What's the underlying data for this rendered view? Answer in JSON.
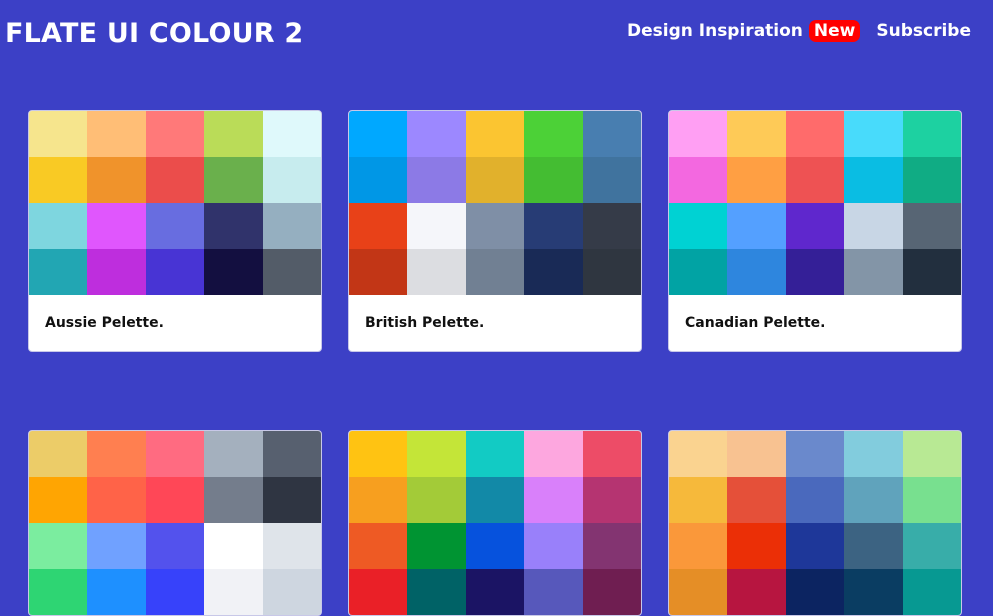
{
  "header": {
    "brand": "FLATE UI COLOUR 2",
    "nav": {
      "inspiration": "Design Inspiration",
      "badge": "New",
      "subscribe": "Subscribe"
    }
  },
  "colors": {
    "background": "#3c40c6",
    "badge": "#ff0000"
  },
  "palettes": [
    {
      "name": "Aussie Pelette.",
      "swatches": [
        "#f6e58d",
        "#ffbe76",
        "#ff7979",
        "#badc58",
        "#dff9fb",
        "#f9ca24",
        "#f0932b",
        "#eb4d4b",
        "#6ab04c",
        "#c7ecee",
        "#7ed6df",
        "#e056fd",
        "#686de0",
        "#30336b",
        "#95afc0",
        "#22a6b3",
        "#be2edd",
        "#4834d4",
        "#130f40",
        "#535c68"
      ]
    },
    {
      "name": "British Pelette.",
      "swatches": [
        "#00a8ff",
        "#9c88ff",
        "#fbc531",
        "#4cd137",
        "#487eb0",
        "#0097e6",
        "#8c7ae6",
        "#e1b12c",
        "#44bd32",
        "#40739e",
        "#e84118",
        "#f5f6fa",
        "#7f8fa6",
        "#273c75",
        "#353b48",
        "#c23616",
        "#dcdde1",
        "#718093",
        "#192a56",
        "#2f3640"
      ]
    },
    {
      "name": "Canadian Pelette.",
      "swatches": [
        "#ff9ff3",
        "#feca57",
        "#ff6b6b",
        "#48dbfb",
        "#1dd1a1",
        "#f368e0",
        "#ff9f43",
        "#ee5253",
        "#0abde3",
        "#10ac84",
        "#00d2d3",
        "#54a0ff",
        "#5f27cd",
        "#c8d6e5",
        "#576574",
        "#01a3a4",
        "#2e86de",
        "#341f97",
        "#8395a7",
        "#222f3e"
      ]
    },
    {
      "swatches": [
        "#eccc68",
        "#ff7f50",
        "#ff6b81",
        "#a4b0be",
        "#57606f",
        "#ffa502",
        "#ff6348",
        "#ff4757",
        "#747d8c",
        "#2f3542",
        "#7bed9f",
        "#70a1ff",
        "#5352ed",
        "#ffffff",
        "#dfe4ea",
        "#2ed573",
        "#1e90ff",
        "#3742fa",
        "#f1f2f6",
        "#ced6e0"
      ]
    },
    {
      "swatches": [
        "#ffc312",
        "#c4e538",
        "#12cbc4",
        "#fda7df",
        "#ed4c67",
        "#f79f1f",
        "#a3cb38",
        "#1289a7",
        "#d980fa",
        "#b53471",
        "#ee5a24",
        "#009432",
        "#0652dd",
        "#9980fa",
        "#833471",
        "#ea2027",
        "#006266",
        "#1b1464",
        "#5758bb",
        "#6f1e51"
      ]
    },
    {
      "swatches": [
        "#fad390",
        "#f8c291",
        "#6a89cc",
        "#82ccdd",
        "#b8e994",
        "#f6b93b",
        "#e55039",
        "#4a69bd",
        "#60a3bc",
        "#78e08f",
        "#fa983a",
        "#eb2f06",
        "#1e3799",
        "#3c6382",
        "#38ada9",
        "#e58e26",
        "#b71540",
        "#0c2461",
        "#0a3d62",
        "#079992"
      ]
    }
  ]
}
